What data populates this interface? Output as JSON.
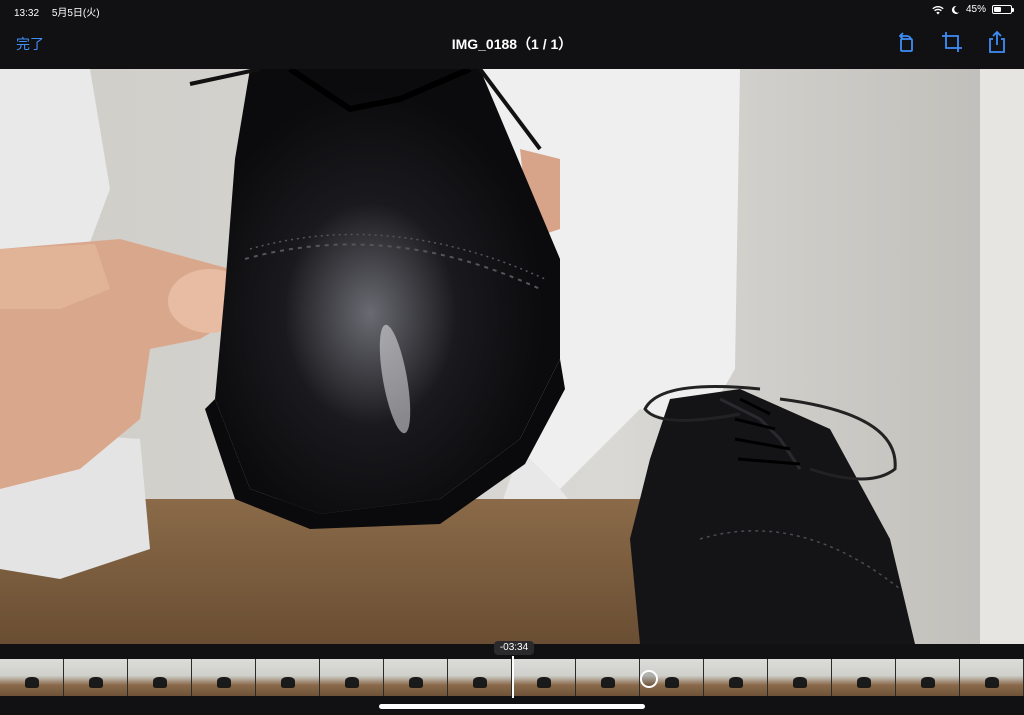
{
  "status": {
    "time": "13:32",
    "date": "5月5日(火)",
    "battery": "45%",
    "battery_level": 0.45
  },
  "nav": {
    "done_label": "完了",
    "title": "IMG_0188（1 / 1）"
  },
  "icons": {
    "rotate": "rotate-icon",
    "crop": "crop-icon",
    "share": "share-icon",
    "wifi": "wifi-icon",
    "moon": "moon-icon",
    "battery": "battery-icon"
  },
  "video": {
    "time_remaining": "-03:34",
    "playhead_fraction": 0.5
  },
  "colors": {
    "accent": "#3e8ef7",
    "background": "#111113"
  }
}
